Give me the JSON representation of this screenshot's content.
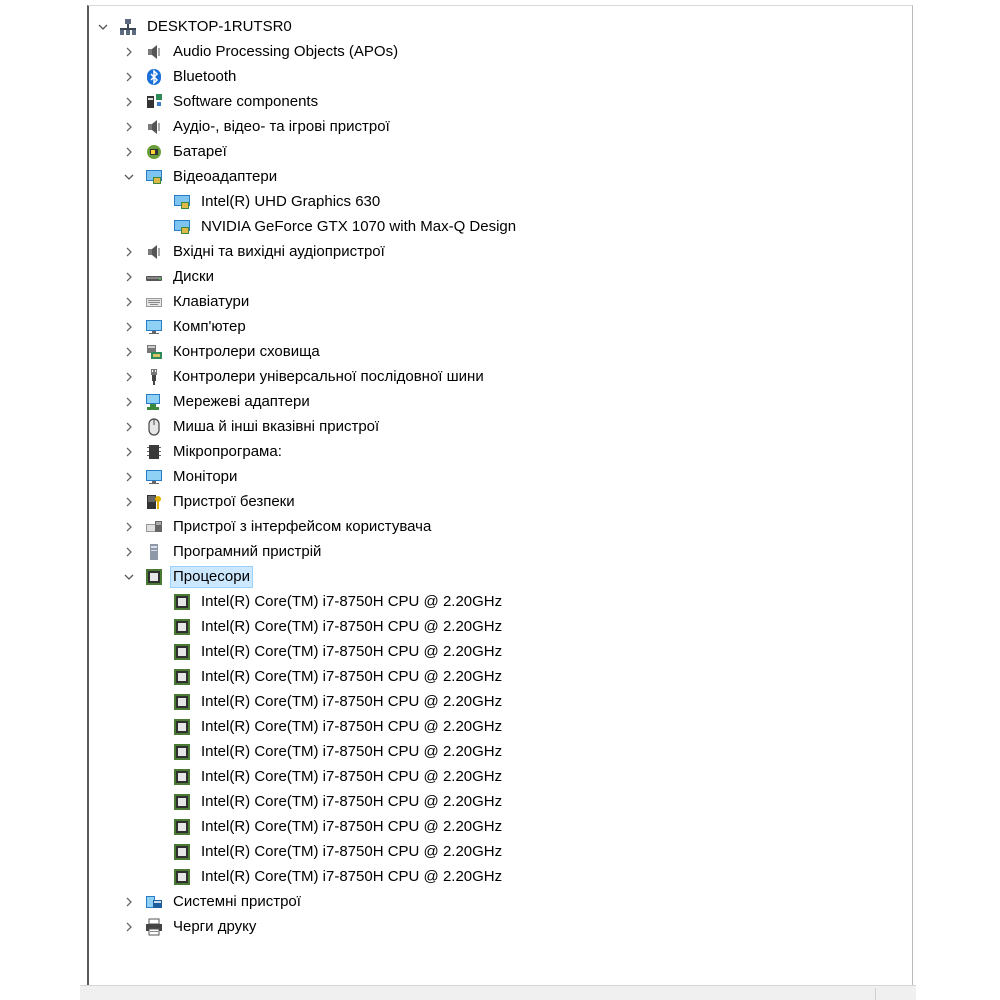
{
  "root": "DESKTOP-1RUTSR0",
  "categories": {
    "apo": "Audio Processing Objects (APOs)",
    "bluetooth": "Bluetooth",
    "software": "Software components",
    "audio_video_game": "Аудіо-, відео- та ігрові пристрої",
    "batteries": "Батареї",
    "display": "Відеоадаптери",
    "audio_io": "Вхідні та вихідні аудіопристрої",
    "disks": "Диски",
    "keyboards": "Клавіатури",
    "computer": "Комп'ютер",
    "storage": "Контролери сховища",
    "usb": "Контролери універсальної послідовної шини",
    "network": "Мережеві адаптери",
    "mice": "Миша й інші вказівні пристрої",
    "firmware": "Мікропрограма:",
    "monitors": "Монітори",
    "security": "Пристрої безпеки",
    "hid": "Пристрої з інтерфейсом користувача",
    "software_device": "Програмний пристрій",
    "processors": "Процесори",
    "system": "Системні пристрої",
    "print_queues": "Черги друку"
  },
  "display_adapters": [
    "Intel(R) UHD Graphics 630",
    "NVIDIA GeForce GTX 1070 with Max-Q Design"
  ],
  "cpu_name": "Intel(R) Core(TM) i7-8750H CPU @ 2.20GHz",
  "cpus": [
    "Intel(R) Core(TM) i7-8750H CPU @ 2.20GHz",
    "Intel(R) Core(TM) i7-8750H CPU @ 2.20GHz",
    "Intel(R) Core(TM) i7-8750H CPU @ 2.20GHz",
    "Intel(R) Core(TM) i7-8750H CPU @ 2.20GHz",
    "Intel(R) Core(TM) i7-8750H CPU @ 2.20GHz",
    "Intel(R) Core(TM) i7-8750H CPU @ 2.20GHz",
    "Intel(R) Core(TM) i7-8750H CPU @ 2.20GHz",
    "Intel(R) Core(TM) i7-8750H CPU @ 2.20GHz",
    "Intel(R) Core(TM) i7-8750H CPU @ 2.20GHz",
    "Intel(R) Core(TM) i7-8750H CPU @ 2.20GHz",
    "Intel(R) Core(TM) i7-8750H CPU @ 2.20GHz",
    "Intel(R) Core(TM) i7-8750H CPU @ 2.20GHz"
  ],
  "colors": {
    "selection": "#cce8ff",
    "selection_border": "#99d1ff",
    "chevron": "#666666"
  }
}
